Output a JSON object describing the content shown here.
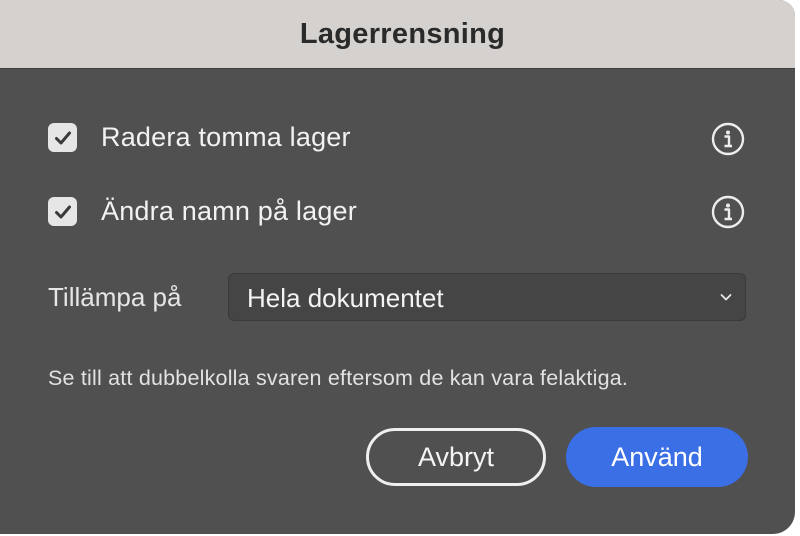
{
  "dialog": {
    "title": "Lagerrensning",
    "options": [
      {
        "label": "Radera tomma lager",
        "checked": true,
        "info_icon": "info-circle-icon"
      },
      {
        "label": "Ändra namn på lager",
        "checked": true,
        "info_icon": "info-circle-icon"
      }
    ],
    "apply_to": {
      "label": "Tillämpa på",
      "selected": "Hela dokumentet",
      "icon": "chevron-down-icon"
    },
    "note": "Se till att dubbelkolla svaren eftersom de kan vara felaktiga.",
    "buttons": {
      "cancel": "Avbryt",
      "apply": "Använd"
    }
  },
  "colors": {
    "titlebar": "#d4d1cf",
    "background": "#505050",
    "accent": "#3b6fe6",
    "checkbox": "#e6e6e6"
  }
}
